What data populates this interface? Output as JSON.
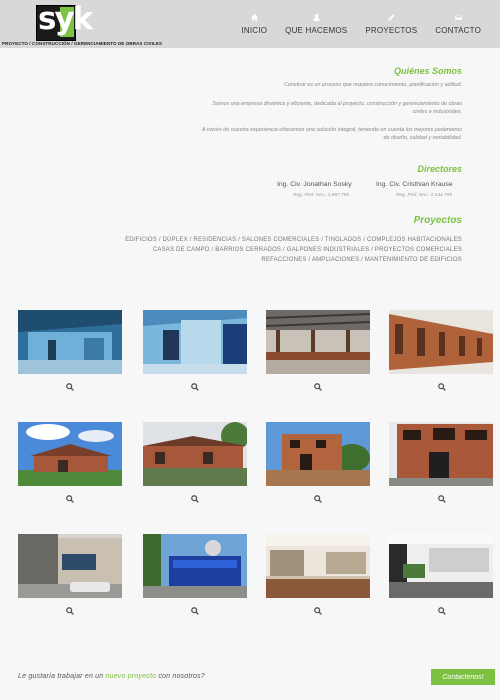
{
  "brand": {
    "logo_text": "syk",
    "tagline": "PROYECTO / CONSTRUCCIÓN / GERENCIAMIENTO DE OBRAS CIVILES"
  },
  "nav": [
    {
      "label": "INICIO",
      "icon": "home-icon"
    },
    {
      "label": "QUE HACEMOS",
      "icon": "user-icon"
    },
    {
      "label": "PROYECTOS",
      "icon": "pencil-icon"
    },
    {
      "label": "CONTACTO",
      "icon": "envelope-icon"
    }
  ],
  "about": {
    "title": "Quiénes Somos",
    "paragraphs": [
      "Construir es un proceso que requiere conocimiento, planificación y actitud.",
      "Somos una empresa dinámica y eficiente, dedicada al proyecto, construcción y gerenciamiento de obras",
      "civiles e industriales.",
      "A través de nuestra experiencia ofrecemos una solución integral, teniendo en cuenta los mejores parámetros",
      "de diseño, calidad y rentabilidad."
    ]
  },
  "directors": {
    "title": "Directores",
    "people": [
      {
        "name": "Ing. Civ. Jonathan Sosky",
        "reg": "Reg. Prof. Nro.: 1.987.755"
      },
      {
        "name": "Ing. Civ. Cristhian Krause",
        "reg": "Reg. Prof. Nro.: 2.344.759"
      }
    ]
  },
  "projects": {
    "title": "Proyectos",
    "lines": [
      "EDIFICIOS / DÚPLEX / RESIDENCIAS / SALONES COMERCIALES / TINGLADOS / COMPLEJOS HABITACIONALES",
      "CASAS DE CAMPO / BARRIOS CERRADOS / GALPONES INDUSTRIALES / PROYECTOS COMERCIALES",
      "REFACCIONES / AMPLIACIONES / MANTENIMIENTO DE EDIFICIOS"
    ]
  },
  "gallery_icon": "zoom-icon",
  "footer": {
    "text_before": "Le gustaría trabajar en un ",
    "text_highlight": "nuevo proyecto",
    "text_after": " con nosotros?",
    "cta_label": "Contactenos!"
  },
  "colors": {
    "accent": "#7dc142",
    "header_bg": "#d8d8d8",
    "page_bg": "#f7f7f7"
  }
}
